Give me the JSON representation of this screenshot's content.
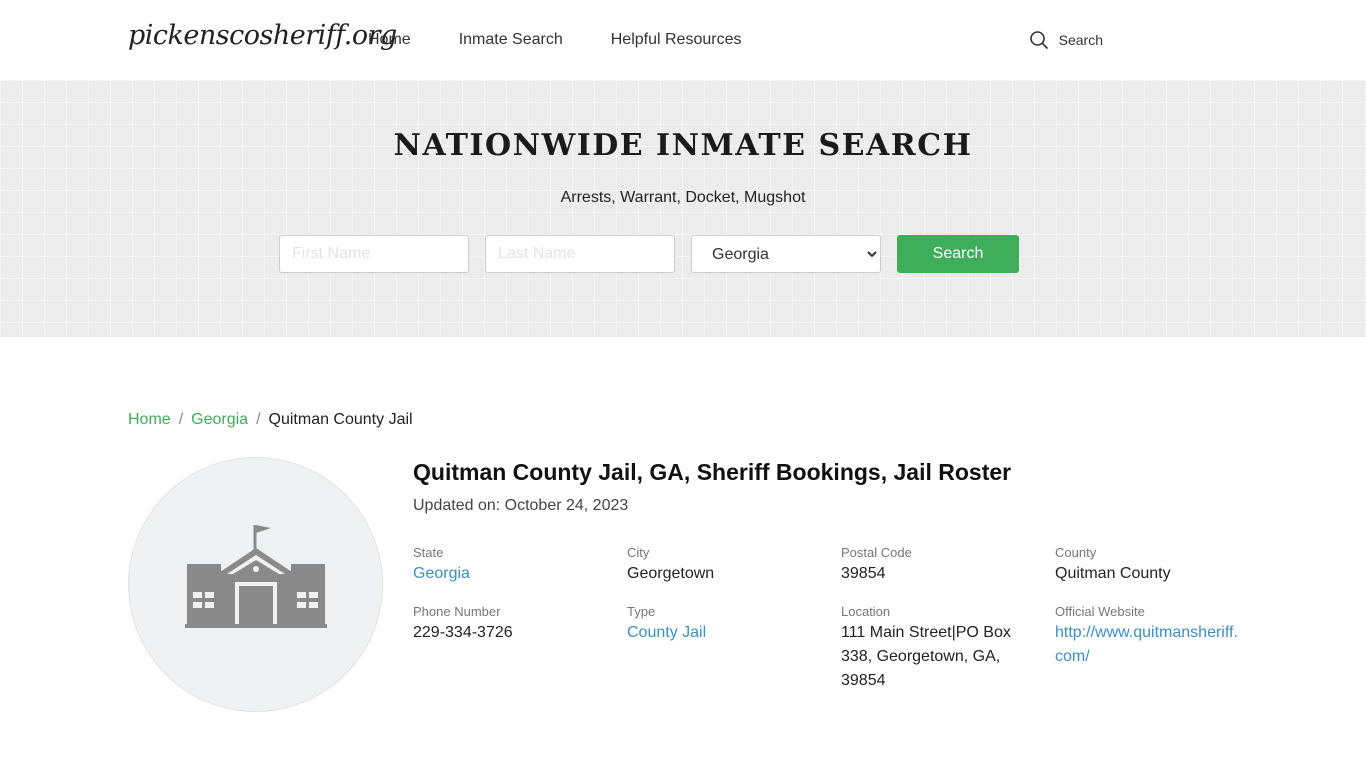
{
  "header": {
    "logo": "pickenscosheriff.org",
    "nav": [
      "Home",
      "Inmate Search",
      "Helpful Resources"
    ],
    "search_label": "Search"
  },
  "hero": {
    "title": "NATIONWIDE INMATE SEARCH",
    "subtitle": "Arrests, Warrant, Docket, Mugshot",
    "first_name_placeholder": "First Name",
    "last_name_placeholder": "Last Name",
    "state_selected": "Georgia",
    "search_button": "Search"
  },
  "breadcrumb": {
    "home": "Home",
    "state": "Georgia",
    "current": "Quitman County Jail",
    "separator": "/"
  },
  "facility": {
    "title": "Quitman County Jail, GA, Sheriff Bookings, Jail Roster",
    "updated": "Updated on: October 24, 2023",
    "icon": "jail-building-icon",
    "fields": {
      "state_label": "State",
      "state": "Georgia",
      "city_label": "City",
      "city": "Georgetown",
      "postal_label": "Postal Code",
      "postal": "39854",
      "county_label": "County",
      "county": "Quitman County",
      "phone_label": "Phone Number",
      "phone": "229-334-3726",
      "type_label": "Type",
      "type": "County Jail",
      "location_label": "Location",
      "location_l1": "111 Main Street|PO Box",
      "location_l2": "338, Georgetown, GA,",
      "location_l3": "39854",
      "website_label": "Official Website",
      "website_l1": "http://www.quitmansheriff.",
      "website_l2": "com/"
    }
  },
  "colors": {
    "accent": "#3fae5a",
    "link": "#3d8fc6"
  }
}
